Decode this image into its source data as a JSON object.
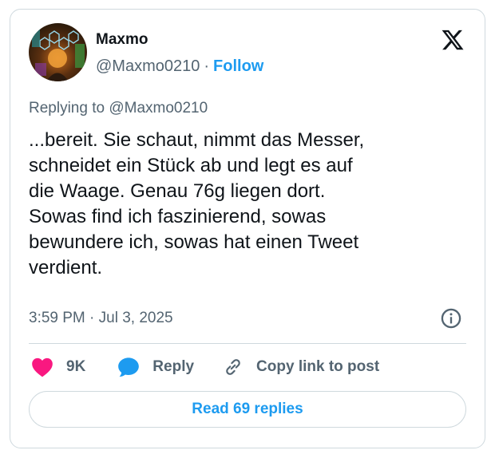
{
  "author": {
    "name": "Maxmo",
    "handle": "@Maxmo0210",
    "separator": "·",
    "follow_label": "Follow",
    "avatar_icon": "avatar-image"
  },
  "platform_icon": "x-logo-icon",
  "replying_to": "Replying to @Maxmo0210",
  "tweet_lines": [
    "...bereit. Sie schaut, nimmt das Messer,",
    "schneidet ein Stück ab und legt es auf",
    "die Waage. Genau 76g liegen dort.",
    "Sowas find ich faszinierend, sowas",
    "bewundere ich, sowas hat einen Tweet",
    "verdient."
  ],
  "timestamp": "3:59 PM · Jul 3, 2025",
  "actions": {
    "likes_count": "9K",
    "reply_label": "Reply",
    "copy_link_label": "Copy link to post"
  },
  "read_replies_label": "Read 69 replies",
  "colors": {
    "accent": "#1d9bf0",
    "like": "#f91880",
    "text": "#0f1419",
    "muted": "#536471",
    "border": "#cfd9de"
  }
}
